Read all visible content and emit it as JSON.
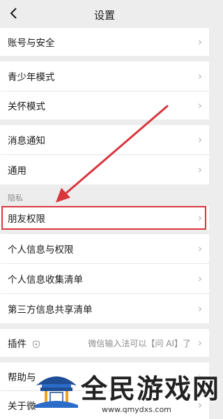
{
  "navbar": {
    "title": "设置"
  },
  "items": {
    "account_security": "账号与安全",
    "teen_mode": "青少年模式",
    "care_mode": "关怀模式",
    "notifications": "消息通知",
    "general": "通用",
    "friend_permissions": "朋友权限",
    "personal_info_permissions": "个人信息与权限",
    "personal_info_collection": "个人信息收集清单",
    "third_party_sharing": "第三方信息共享清单",
    "plugins": "插件",
    "plugins_value": "微信输入法可以【问 AI】了",
    "help": "帮助与",
    "about": "关于微"
  },
  "sections": {
    "privacy": "隐私"
  },
  "watermark": {
    "brand": "全民游戏网",
    "url": "www.qmydxs.com"
  },
  "colors": {
    "highlight": "#d9363e",
    "background": "#ededed"
  },
  "chevron": "›"
}
